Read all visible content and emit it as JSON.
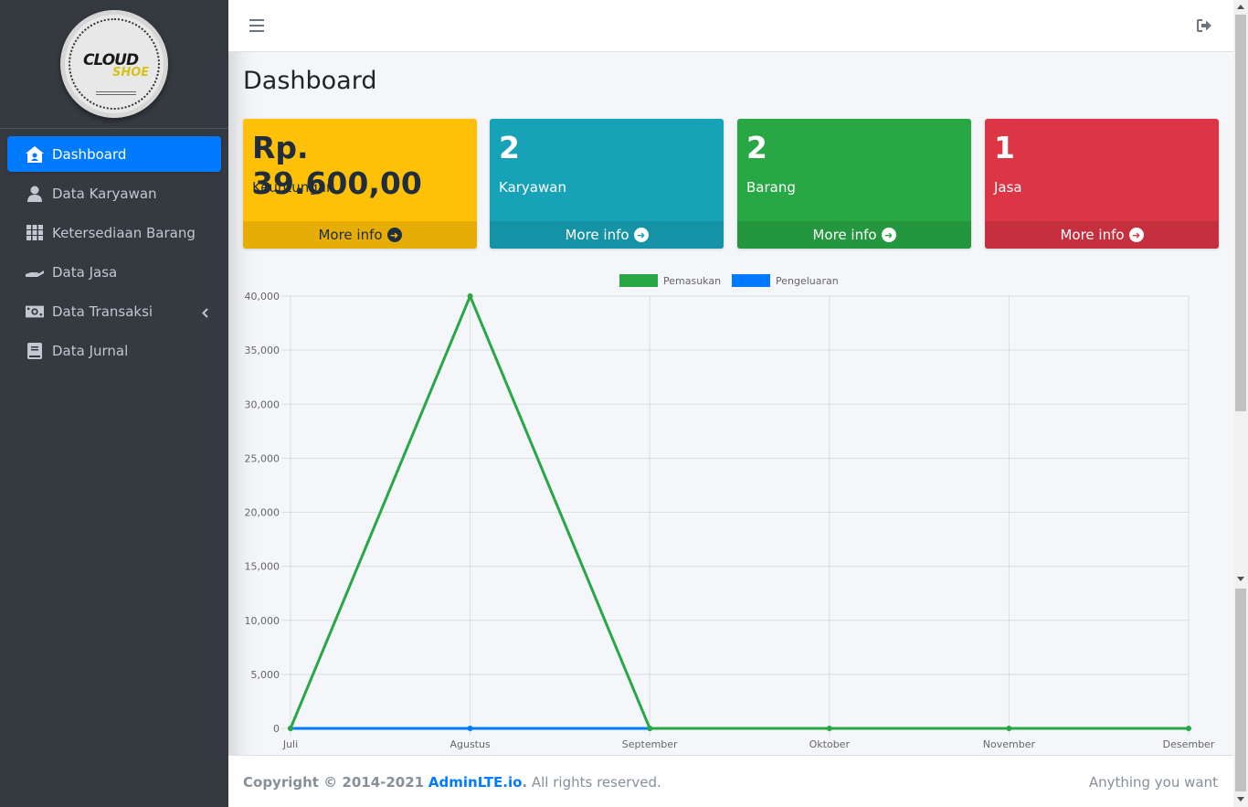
{
  "sidebar": {
    "logo_text_1": "CLOUD",
    "logo_text_2": "SHOE",
    "items": [
      {
        "label": "Dashboard",
        "icon": "home-icon",
        "active": true
      },
      {
        "label": "Data Karyawan",
        "icon": "user-icon"
      },
      {
        "label": "Ketersediaan Barang",
        "icon": "grid-icon"
      },
      {
        "label": "Data Jasa",
        "icon": "hand-icon"
      },
      {
        "label": "Data Transaksi",
        "icon": "money-icon",
        "has_arrow": true
      },
      {
        "label": "Data Jurnal",
        "icon": "book-icon"
      }
    ]
  },
  "header": {
    "menu_icon": "hamburger-icon",
    "logout_icon": "sign-out-icon"
  },
  "main": {
    "title": "Dashboard",
    "boxes": [
      {
        "value": "Rp. 39.600,00",
        "label": "Keuntungan",
        "more": "More info",
        "color": "#ffc107"
      },
      {
        "value": "2",
        "label": "Karyawan",
        "more": "More info",
        "color": "#17a2b8"
      },
      {
        "value": "2",
        "label": "Barang",
        "more": "More info",
        "color": "#28a745"
      },
      {
        "value": "1",
        "label": "Jasa",
        "more": "More info",
        "color": "#dc3545"
      }
    ]
  },
  "chart_data": {
    "type": "line",
    "categories": [
      "Juli",
      "Agustus",
      "September",
      "Oktober",
      "November",
      "Desember"
    ],
    "series": [
      {
        "name": "Pemasukan",
        "color": "#28a745",
        "values": [
          0,
          40000,
          0,
          0,
          0,
          0
        ]
      },
      {
        "name": "Pengeluaran",
        "color": "#007bff",
        "values": [
          0,
          0,
          0,
          null,
          null,
          null
        ]
      }
    ],
    "ylim": [
      0,
      40000
    ],
    "yticks": [
      "40,000",
      "35,000",
      "30,000",
      "25,000",
      "20,000",
      "15,000",
      "10,000",
      "5,000",
      "0"
    ],
    "legend": "top",
    "grid": true
  },
  "footer": {
    "copyright": "Copyright © 2014-2021",
    "link": "AdminLTE.io",
    "period": ".",
    "rights": " All rights reserved.",
    "right_text": "Anything you want"
  }
}
